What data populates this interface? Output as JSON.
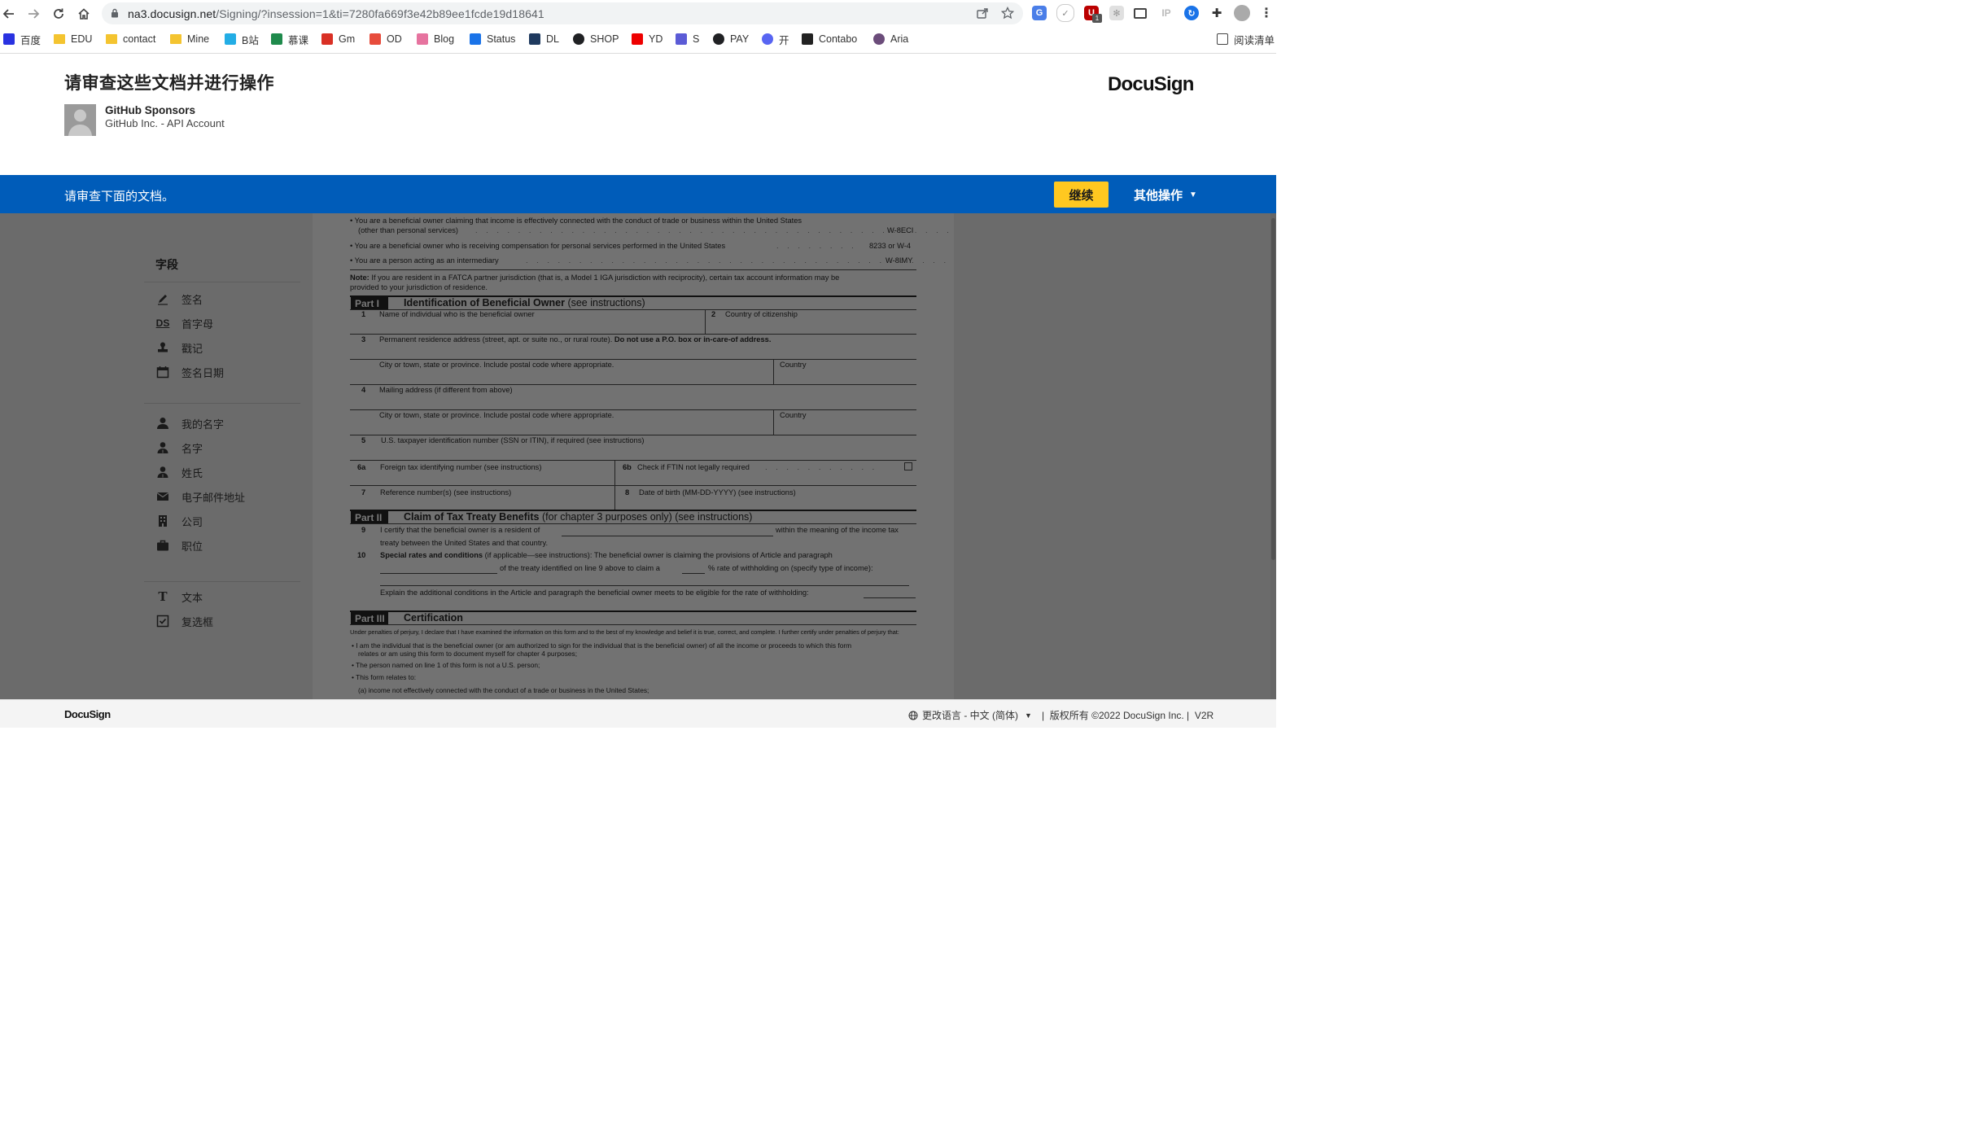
{
  "browser": {
    "url_domain": "na3.docusign.net",
    "url_path": "/Signing/?insession=1&ti=7280fa669f3e42b89ee1fcde19d18641",
    "ext_badge": "1",
    "ext_ip": "IP",
    "reading_list": "阅读清单",
    "bookmarks": [
      {
        "label": "百度",
        "icon": "baidu-icon",
        "color": "#2932e1"
      },
      {
        "label": "EDU",
        "icon": "folder-icon",
        "color": "#f4c430"
      },
      {
        "label": "contact",
        "icon": "folder-icon",
        "color": "#f4c430"
      },
      {
        "label": "Mine",
        "icon": "folder-icon",
        "color": "#f4c430"
      },
      {
        "label": "B站",
        "icon": "bilibili-icon",
        "color": "#23ade5"
      },
      {
        "label": "慕课",
        "icon": "mooc-icon",
        "color": "#1f8a4c"
      },
      {
        "label": "Gm",
        "icon": "gmail-icon",
        "color": "#d93025"
      },
      {
        "label": "OD",
        "icon": "office-icon",
        "color": "#e74c3c"
      },
      {
        "label": "Blog",
        "icon": "blog-icon",
        "color": "#e6739f"
      },
      {
        "label": "Status",
        "icon": "shield-check-icon",
        "color": "#1a73e8"
      },
      {
        "label": "DL",
        "icon": "dl-icon",
        "color": "#1f3a5f"
      },
      {
        "label": "SHOP",
        "icon": "globe-icon",
        "color": "#202124"
      },
      {
        "label": "YD",
        "icon": "yd-icon",
        "color": "#e00"
      },
      {
        "label": "S",
        "icon": "s-icon",
        "color": "#5b5bd6"
      },
      {
        "label": "PAY",
        "icon": "globe-icon",
        "color": "#202124"
      },
      {
        "label": "开",
        "icon": "discord-icon",
        "color": "#5865f2"
      },
      {
        "label": "Contabo",
        "icon": "bt-icon",
        "color": "#222"
      },
      {
        "label": "Aria",
        "icon": "aria-icon",
        "color": "#6b4c7a"
      }
    ]
  },
  "header": {
    "title": "请审查这些文档并进行操作",
    "sender_name": "GitHub Sponsors",
    "sender_company": "GitHub Inc. - API Account",
    "logo": "DocuSign"
  },
  "action_bar": {
    "message": "请审查下面的文档。",
    "continue": "继续",
    "more_actions": "其他操作"
  },
  "fields_panel": {
    "title": "字段",
    "groups": [
      [
        {
          "label": "签名",
          "icon": "pen-icon"
        },
        {
          "label": "首字母",
          "icon": "ds-initials-icon",
          "glyph": "DS"
        },
        {
          "label": "戳记",
          "icon": "stamp-icon"
        },
        {
          "label": "签名日期",
          "icon": "calendar-icon"
        }
      ],
      [
        {
          "label": "我的名字",
          "icon": "person-icon"
        },
        {
          "label": "名字",
          "icon": "person-outline-icon"
        },
        {
          "label": "姓氏",
          "icon": "person-outline-icon"
        },
        {
          "label": "电子邮件地址",
          "icon": "envelope-icon"
        },
        {
          "label": "公司",
          "icon": "building-icon"
        },
        {
          "label": "职位",
          "icon": "briefcase-icon"
        }
      ],
      [
        {
          "label": "文本",
          "icon": "text-icon",
          "glyph": "T"
        },
        {
          "label": "复选框",
          "icon": "checkbox-icon"
        }
      ]
    ]
  },
  "document": {
    "bullet1a": "• You are a beneficial owner claiming that income is effectively connected with the conduct of trade or business within the United States",
    "bullet1b": "(other than personal services)",
    "form1": "W-8ECI",
    "bullet2": "• You are a beneficial owner who is receiving compensation for personal services performed in the United States",
    "form2": "8233 or W-4",
    "bullet3": "• You are a person acting as an intermediary",
    "form3": "W-8IMY",
    "note_label": "Note:",
    "note_a": "If you are resident in a FATCA partner jurisdiction (that is, a Model 1 IGA jurisdiction with reciprocity), certain tax account information may be",
    "note_b": "provided to your jurisdiction of residence.",
    "part1_label": "Part I",
    "part1_title": "Identification of Beneficial Owner",
    "part1_see": "(see instructions)",
    "l1_num": "1",
    "l1": "Name of individual who is the beneficial owner",
    "l2_num": "2",
    "l2": "Country of citizenship",
    "l3_num": "3",
    "l3": "Permanent residence address (street, apt. or suite no., or rural route).",
    "l3_bold": "Do not use a P.O. box or in-care-of address.",
    "city1": "City or town, state or province. Include postal code where appropriate.",
    "country1": "Country",
    "l4_num": "4",
    "l4": "Mailing address (if different from above)",
    "city2": "City or town, state or province. Include postal code where appropriate.",
    "country2": "Country",
    "l5_num": "5",
    "l5": "U.S. taxpayer identification number (SSN or ITIN), if required (see instructions)",
    "l6a_num": "6a",
    "l6a": "Foreign tax identifying number (see instructions)",
    "l6b_num": "6b",
    "l6b": "Check if FTIN not legally required",
    "l7_num": "7",
    "l7": "Reference number(s) (see instructions)",
    "l8_num": "8",
    "l8": "Date of birth (MM-DD-YYYY) (see instructions)",
    "part2_label": "Part II",
    "part2_title": "Claim of Tax Treaty Benefits",
    "part2_see": "(for chapter 3 purposes only) (see instructions)",
    "l9_num": "9",
    "l9a": "I certify that the beneficial owner is a resident of",
    "l9b": "within the meaning of the income tax",
    "l9c": "treaty between the United States and that country.",
    "l10_num": "10",
    "l10_bold": "Special rates and conditions",
    "l10a": "(if applicable—see instructions): The beneficial owner is claiming the provisions of Article and paragraph",
    "l10b": "of the treaty identified on line 9 above to claim a",
    "l10c": "% rate of withholding on (specify type of income):",
    "l10d": "Explain the additional conditions in the Article and paragraph the beneficial owner meets to be eligible for the rate of withholding:",
    "part3_label": "Part III",
    "part3_title": "Certification",
    "perjury": "Under penalties of perjury, I declare that I have examined the information on this form and to the best of my knowledge and belief it is true, correct, and complete. I further certify under penalties of perjury that:",
    "c1a": "• I am the individual that is the beneficial owner (or am authorized to sign for the individual that is the beneficial owner) of all the income or proceeds to which this form",
    "c1b": "relates or am using this form to document myself for chapter 4 purposes;",
    "c2": "• The person named on line 1 of this form is not a U.S. person;",
    "c3": "• This form relates to:",
    "c4": "(a) income not effectively connected with the conduct of a trade or business in the United States;"
  },
  "footer": {
    "logo": "DocuSign",
    "language": "更改语言 - 中文 (简体)",
    "copyright": "版权所有 ©2022 DocuSign Inc.",
    "version": "V2R"
  }
}
